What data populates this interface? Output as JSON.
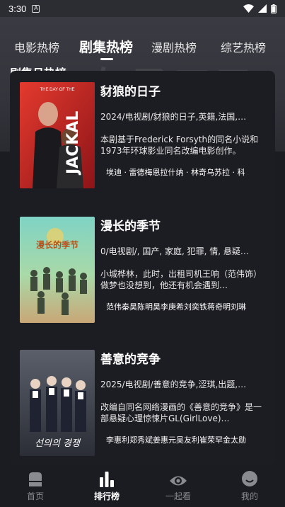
{
  "status_bar": {
    "time": "3:30",
    "app_indicator": "A"
  },
  "tabs": [
    {
      "label": "电影热榜",
      "active": false
    },
    {
      "label": "剧集热榜",
      "active": true
    },
    {
      "label": "漫剧热榜",
      "active": false
    },
    {
      "label": "综艺热榜",
      "active": false
    }
  ],
  "section_title": "剧集月热榜",
  "items": [
    {
      "title": "豺狼的日子",
      "meta": "2024/电视剧/豺狼的日子,英籍,法国,…",
      "desc": "本剧基于Frederick Forsyth的同名小说和1973年环球影业同名改编电影创作。",
      "cast": "埃迪 · 雷德梅恩拉什纳 · 林奇乌苏拉 · 科",
      "poster_caption": "THE DAY OF THE",
      "poster_title": "JACKAL"
    },
    {
      "title": "漫长的季节",
      "meta": "0/电视剧/, 国产, 家庭, 犯罪, 情, 悬疑…",
      "desc": "小城桦林，此时，出租司机王响（范伟饰）做梦也没想到，他还有机会遇到…",
      "cast": "范伟秦昊陈明昊李庚希刘奕铁蒋奇明刘琳",
      "poster_caption": "",
      "poster_title": "漫长的季节"
    },
    {
      "title": "善意的竞争",
      "meta": "2025/电视剧/善意的竞争,涩琪,出题,…",
      "desc": "改编自同名网络漫画的《善意的竞争》是一部悬疑心理惊悚片GL(GirlLove)…",
      "cast": "李惠利郑秀斌姜惠元吴友利崔荣罕金太勋",
      "poster_caption": "",
      "poster_title": "선의의 경쟁"
    }
  ],
  "bottom_nav": [
    {
      "label": "首页",
      "icon": "home-icon",
      "active": false
    },
    {
      "label": "排行榜",
      "icon": "ranking-icon",
      "active": true
    },
    {
      "label": "一起看",
      "icon": "eye-icon",
      "active": false
    },
    {
      "label": "我的",
      "icon": "profile-icon",
      "active": false
    }
  ],
  "colors": {
    "background": "#1b1c21",
    "header": "#3a3b42",
    "active_nav": "#ffffff",
    "inactive_nav": "#8a8b90"
  }
}
